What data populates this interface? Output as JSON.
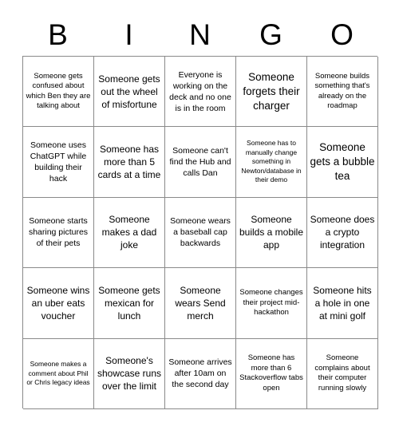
{
  "header": {
    "letters": [
      "B",
      "I",
      "N",
      "G",
      "O"
    ]
  },
  "grid": {
    "columns": 5,
    "rows": 5,
    "border_color": "#8a8a8a",
    "background_color": "#ffffff",
    "text_color": "#000000",
    "cells": [
      {
        "text": "Someone gets confused about which Ben they are talking about",
        "size": "s"
      },
      {
        "text": "Someone gets out the wheel of misfortune",
        "size": "l"
      },
      {
        "text": "Everyone is working on the deck and no one is in the room",
        "size": "m"
      },
      {
        "text": "Someone forgets their charger",
        "size": "xl"
      },
      {
        "text": "Someone builds something that's already on the roadmap",
        "size": "s"
      },
      {
        "text": "Someone uses ChatGPT while building their hack",
        "size": "m"
      },
      {
        "text": "Someone has more than 5 cards at a time",
        "size": "l"
      },
      {
        "text": "Someone can't find the Hub and calls Dan",
        "size": "m"
      },
      {
        "text": "Someone has to manually change something in Newton/database in their demo",
        "size": "xs"
      },
      {
        "text": "Someone gets a bubble tea",
        "size": "xl"
      },
      {
        "text": "Someone starts sharing pictures of their pets",
        "size": "m"
      },
      {
        "text": "Someone makes a dad joke",
        "size": "l"
      },
      {
        "text": "Someone wears a baseball cap backwards",
        "size": "m"
      },
      {
        "text": "Someone builds a mobile app",
        "size": "l"
      },
      {
        "text": "Someone does a crypto integration",
        "size": "l"
      },
      {
        "text": "Someone wins an uber eats voucher",
        "size": "l"
      },
      {
        "text": "Someone gets mexican for lunch",
        "size": "l"
      },
      {
        "text": "Someone wears Send merch",
        "size": "l"
      },
      {
        "text": "Someone changes their project mid-hackathon",
        "size": "s"
      },
      {
        "text": "Someone hits a hole in one at mini golf",
        "size": "l"
      },
      {
        "text": "Someone makes a comment about Phil or Chris legacy ideas",
        "size": "xs"
      },
      {
        "text": "Someone's showcase runs over the limit",
        "size": "l"
      },
      {
        "text": "Someone arrives after 10am on the second day",
        "size": "m"
      },
      {
        "text": "Someone has more than 6 Stackoverflow tabs open",
        "size": "s"
      },
      {
        "text": "Someone complains about their computer running slowly",
        "size": "s"
      }
    ]
  }
}
